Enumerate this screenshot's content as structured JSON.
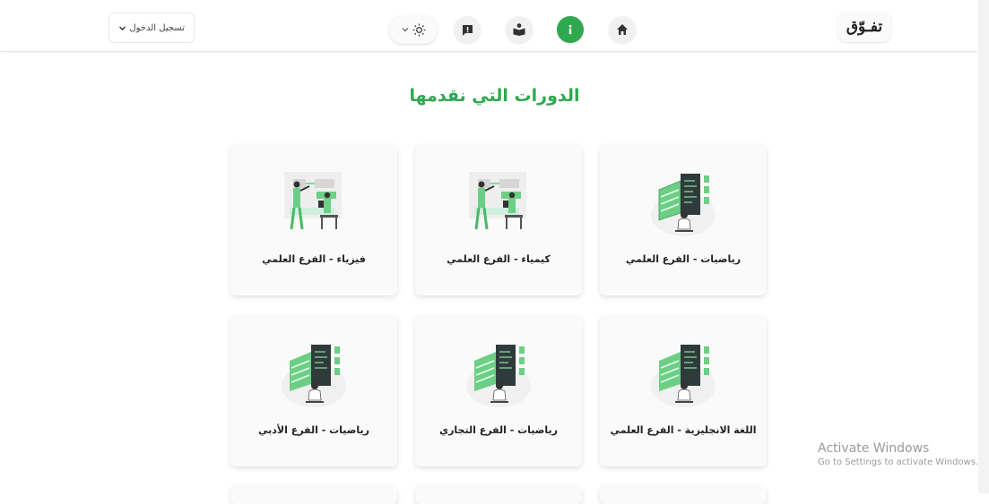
{
  "header": {
    "logo": "تفـوّق",
    "login_label": "تسجيل الدخول"
  },
  "nav": {
    "items": [
      "home-icon",
      "info-icon",
      "reader-icon",
      "report-icon",
      "theme-sun-icon"
    ],
    "accent": "#2fa84f"
  },
  "main": {
    "heading": "الدورات التي نقدمها",
    "courses": [
      {
        "title": "رياضيات - الفرع العلمي",
        "illustration": "server-person-illustration"
      },
      {
        "title": "كيمياء - الفرع العلمي",
        "illustration": "presentation-illustration"
      },
      {
        "title": "فيزياء - الفرع العلمي",
        "illustration": "presentation-illustration"
      },
      {
        "title": "اللغة الانجليزية - الفرع العلمي",
        "illustration": "server-person-illustration"
      },
      {
        "title": "رياضيات - الفرع التجاري",
        "illustration": "server-person-illustration"
      },
      {
        "title": "رياضيات - الفرع الأدبي",
        "illustration": "server-person-illustration"
      }
    ]
  },
  "watermark": {
    "title": "Activate Windows",
    "subtitle": "Go to Settings to activate Windows."
  }
}
